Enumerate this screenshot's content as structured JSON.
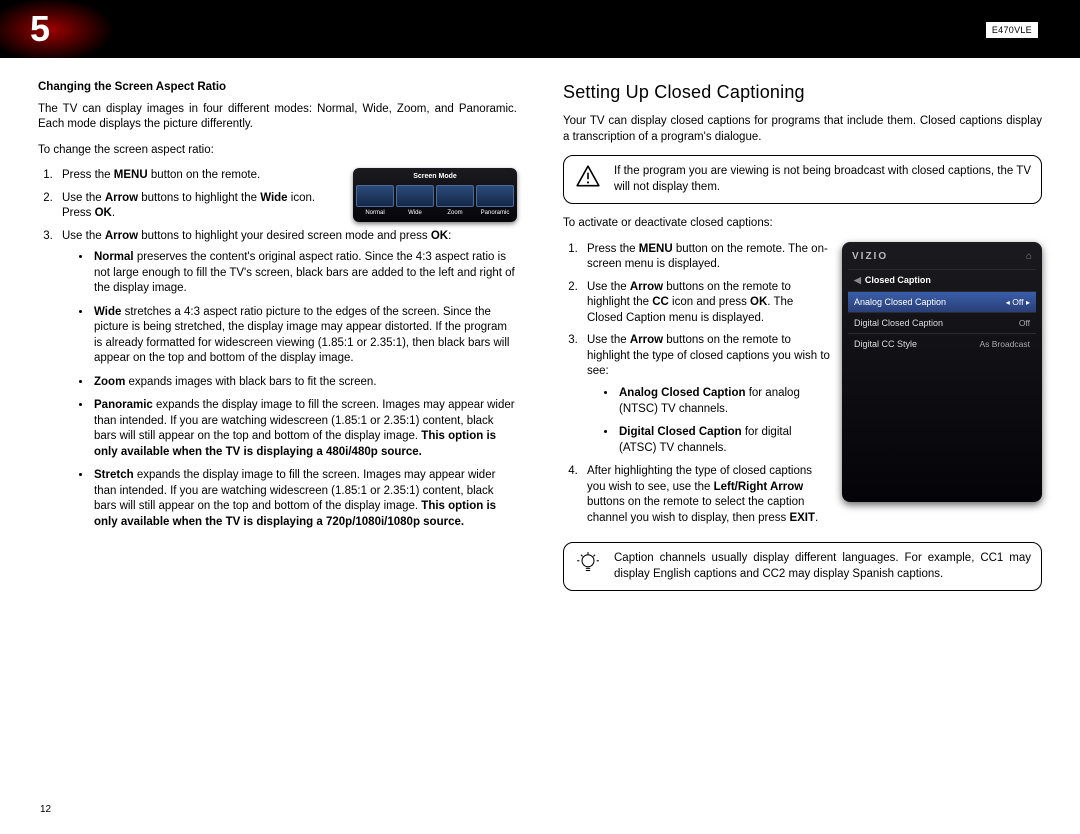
{
  "header": {
    "chapter_number": "5",
    "model": "E470VLE"
  },
  "page_number": "12",
  "left": {
    "subhead": "Changing the Screen Aspect Ratio",
    "intro": "The TV can display images in four different modes: Normal, Wide, Zoom, and Panoramic. Each mode displays the picture differently.",
    "lead": "To change the screen aspect ratio:",
    "steps": {
      "s1_a": "Press the ",
      "s1_b": "MENU",
      "s1_c": " button on the remote.",
      "s2_a": "Use the ",
      "s2_b": "Arrow",
      "s2_c": " buttons to highlight the ",
      "s2_d": "Wide",
      "s2_e": " icon. Press ",
      "s2_f": "OK",
      "s2_g": ".",
      "s3_a": "Use the ",
      "s3_b": "Arrow",
      "s3_c": " buttons to highlight your desired screen mode and press ",
      "s3_d": "OK",
      "s3_e": ":"
    },
    "modes": {
      "normal_t": "Normal",
      "normal_b": " preserves the content's original aspect ratio. Since the 4:3 aspect ratio is not large enough to fill the TV's screen, black bars are added to the left and right of the display image.",
      "wide_t": "Wide",
      "wide_b": " stretches a 4:3 aspect ratio picture to the edges of the screen. Since the picture is being stretched, the display image may appear distorted. If the program is already formatted for widescreen viewing (1.85:1 or 2.35:1), then black bars will appear on the top and bottom of the display image.",
      "zoom_t": "Zoom",
      "zoom_b": " expands images with black bars to fit the screen.",
      "pan_t": "Panoramic",
      "pan_b1": " expands the display image to fill the screen. Images may appear wider than intended. If you are watching widescreen (1.85:1 or 2.35:1) content, black bars will still appear on the top and bottom of the display image. ",
      "pan_b2": "This option is only available when the TV is displaying a 480i/480p source.",
      "stretch_t": "Stretch",
      "stretch_b1": " expands the display image to fill the screen. Images may appear wider than intended. If you are watching widescreen (1.85:1 or 2.35:1) content, black bars will still appear on the top and bottom of the display image. ",
      "stretch_b2": "This option is only available when the TV is displaying a 720p/1080i/1080p source."
    },
    "screenmode": {
      "title": "Screen Mode",
      "opts": [
        "Normal",
        "Wide",
        "Zoom",
        "Panoramic"
      ]
    }
  },
  "right": {
    "heading": "Setting Up Closed Captioning",
    "intro": "Your TV can display closed captions for programs that include them. Closed captions display a transcription of a program's dialogue.",
    "warn": "If the program you are viewing is not being broadcast with closed captions, the TV will not display them.",
    "lead": "To activate or deactivate closed captions:",
    "steps": {
      "s1_a": "Press the ",
      "s1_b": "MENU",
      "s1_c": " button on the remote. The on-screen menu is displayed.",
      "s2_a": "Use the ",
      "s2_b": "Arrow",
      "s2_c": " buttons on the remote to highlight the ",
      "s2_d": "CC",
      "s2_e": " icon and press ",
      "s2_f": "OK",
      "s2_g": ". The Closed Caption menu is displayed.",
      "s3_a": "Use the ",
      "s3_b": "Arrow",
      "s3_c": " buttons on the remote to highlight the type of closed captions you wish to see:",
      "analog_t": "Analog Closed Caption",
      "analog_b": " for analog (NTSC) TV channels.",
      "digital_t": "Digital Closed Caption",
      "digital_b": " for digital (ATSC) TV channels.",
      "s4_a": "After highlighting the type of closed captions you wish to see, use the ",
      "s4_b": "Left/Right Arrow",
      "s4_c": " buttons on the remote to select the caption channel you wish to display, then press ",
      "s4_d": "EXIT",
      "s4_e": "."
    },
    "tip": "Caption channels usually display different languages. For example, CC1 may display English captions and CC2 may display Spanish captions.",
    "ccmenu": {
      "brand": "VIZIO",
      "title": "Closed Caption",
      "rows": [
        {
          "label": "Analog Closed Caption",
          "value": "Off",
          "selected": true
        },
        {
          "label": "Digital Closed Caption",
          "value": "Off",
          "selected": false
        },
        {
          "label": "Digital CC Style",
          "value": "As Broadcast",
          "selected": false
        }
      ]
    }
  }
}
